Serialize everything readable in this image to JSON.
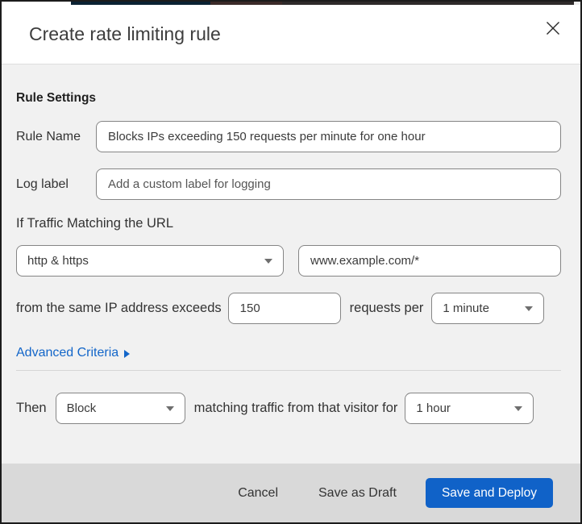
{
  "modal": {
    "title": "Create rate limiting rule"
  },
  "form": {
    "section_heading": "Rule Settings",
    "rule_name": {
      "label": "Rule Name",
      "value": "Blocks IPs exceeding 150 requests per minute for one hour"
    },
    "log_label": {
      "label": "Log label",
      "placeholder": "Add a custom label for logging"
    },
    "traffic_match": {
      "heading": "If Traffic Matching the URL",
      "scheme_select_value": "http & https",
      "url_value": "www.example.com/*"
    },
    "threshold": {
      "prefix": "from the same IP address exceeds",
      "requests_value": "150",
      "middle": "requests per",
      "period_select_value": "1 minute"
    },
    "advanced_criteria_label": "Advanced Criteria",
    "action": {
      "prefix": "Then",
      "action_select_value": "Block",
      "middle": "matching traffic from that visitor for",
      "duration_select_value": "1 hour"
    }
  },
  "footer": {
    "cancel_label": "Cancel",
    "save_draft_label": "Save as Draft",
    "save_deploy_label": "Save and Deploy"
  },
  "colors": {
    "primary_button_blue": "#1062c8",
    "link_blue": "#1366c9",
    "body_background": "#f1f1f1",
    "footer_background": "#d9d9d9"
  }
}
